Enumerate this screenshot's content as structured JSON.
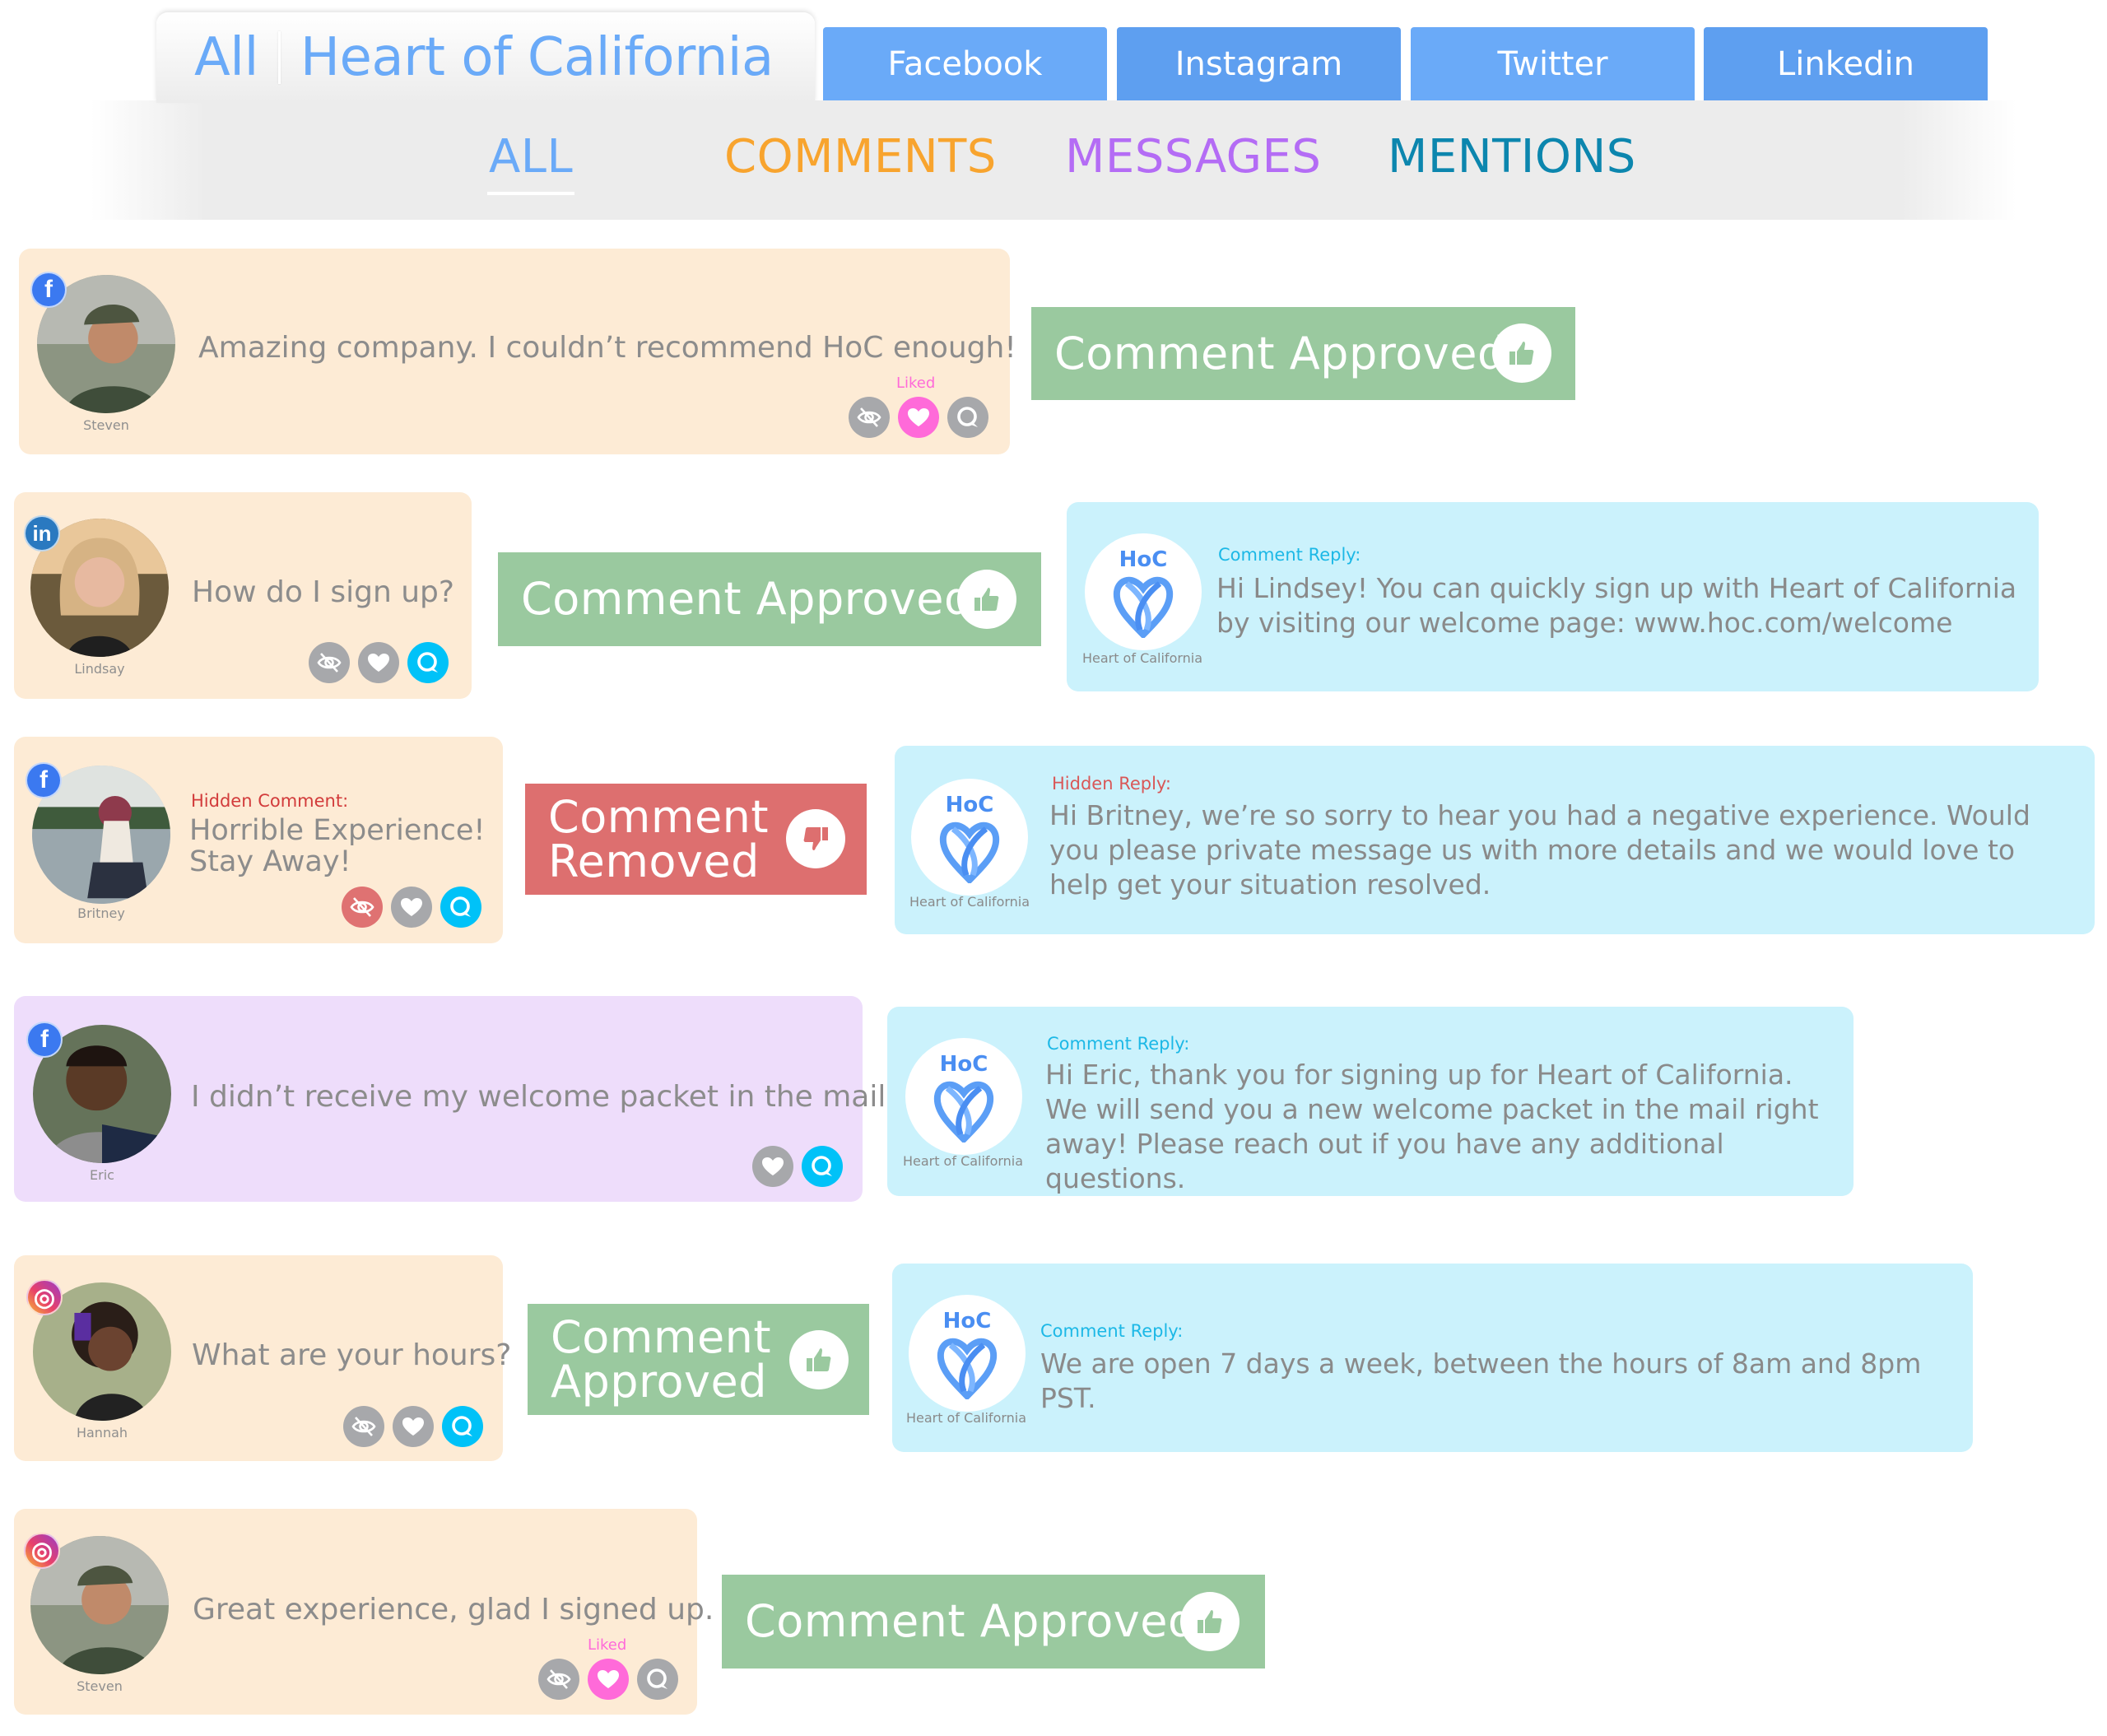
{
  "header": {
    "scope_label": "All",
    "brand_label": "Heart of California",
    "platform_tabs": [
      {
        "label": "Facebook",
        "color": "#6aaaf8"
      },
      {
        "label": "Instagram",
        "color": "#5e9ff0"
      },
      {
        "label": "Twitter",
        "color": "#6aaaf8"
      },
      {
        "label": "Linkedin",
        "color": "#5e9ff0"
      }
    ],
    "sub_tabs": [
      {
        "label": "ALL",
        "color": "#6aaaf8",
        "active": true
      },
      {
        "label": "COMMENTS",
        "color": "#f8a42e",
        "active": false
      },
      {
        "label": "MESSAGES",
        "color": "#b46cf5",
        "active": false
      },
      {
        "label": "MENTIONS",
        "color": "#0c86ae",
        "active": false
      }
    ]
  },
  "colors": {
    "comment_card_bg": "#fdebd5",
    "message_card_bg": "#eeddfb",
    "reply_card_bg": "#cbf2fc",
    "approved": "#9ac99f",
    "removed": "#dd6f6f",
    "liked": "#ff6ad9",
    "reply_active": "#00c2f8",
    "icon_inactive": "#a7a8ab"
  },
  "feed": [
    {
      "type": "comment",
      "network": "facebook",
      "user": "Steven",
      "text": "Amazing company. I couldn’t recommend HoC enough!",
      "actions": {
        "hide": "inactive",
        "like": "liked",
        "reply": "inactive"
      },
      "liked_label": "Liked",
      "status": "Comment Approved",
      "reply": null
    },
    {
      "type": "comment",
      "network": "linkedin",
      "user": "Lindsay",
      "text": "How do I sign up?",
      "actions": {
        "hide": "inactive",
        "like": "inactive",
        "reply": "active"
      },
      "status": "Comment Approved",
      "reply": {
        "label": "Comment Reply:",
        "author": "Heart of California",
        "logo_text": "HoC",
        "text": "Hi Lindsey! You can quickly sign up with Heart of California by visiting our welcome page: www.hoc.com/welcome"
      }
    },
    {
      "type": "comment",
      "network": "facebook",
      "user": "Britney",
      "hidden_label": "Hidden Comment:",
      "text": "Horrible Experience! Stay Away!",
      "actions": {
        "hide": "hidden",
        "like": "inactive",
        "reply": "active"
      },
      "status": "Comment Removed",
      "reply": {
        "label": "Hidden Reply:",
        "author": "Heart of California",
        "logo_text": "HoC",
        "text": "Hi Britney, we’re so sorry to hear you had a negative experience. Would you please private message us with more details and we would love to help get your situation resolved."
      }
    },
    {
      "type": "message",
      "network": "facebook",
      "user": "Eric",
      "text": "I didn’t receive my welcome packet in the mail.",
      "actions": {
        "like": "inactive",
        "reply": "active"
      },
      "status": null,
      "reply": {
        "label": "Comment Reply:",
        "author": "Heart of California",
        "logo_text": "HoC",
        "text": "Hi Eric, thank you for signing up for Heart of California. We will send you a new welcome packet in the mail right away! Please reach out if you have any additional questions."
      }
    },
    {
      "type": "comment",
      "network": "instagram",
      "user": "Hannah",
      "text": "What are your hours?",
      "actions": {
        "hide": "inactive",
        "like": "inactive",
        "reply": "active"
      },
      "status": "Comment Approved",
      "reply": {
        "label": "Comment Reply:",
        "author": "Heart of California",
        "logo_text": "HoC",
        "text": "We are open 7 days a week, between the hours of 8am and 8pm PST."
      }
    },
    {
      "type": "comment",
      "network": "instagram",
      "user": "Steven",
      "text": "Great experience, glad I signed up.",
      "actions": {
        "hide": "inactive",
        "like": "liked",
        "reply": "inactive"
      },
      "liked_label": "Liked",
      "status": "Comment Approved",
      "reply": null
    }
  ]
}
